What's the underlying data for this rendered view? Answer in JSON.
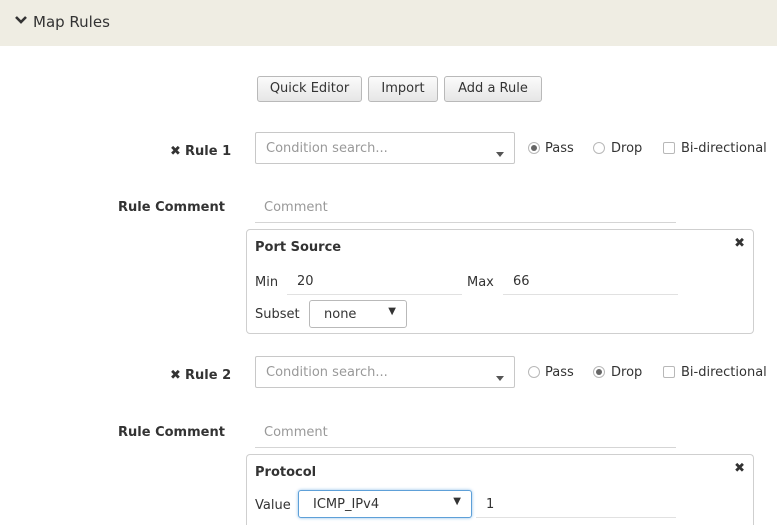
{
  "header": {
    "title": "Map Rules"
  },
  "toolbar": {
    "quick_editor": "Quick Editor",
    "import": "Import",
    "add_rule": "Add a Rule"
  },
  "rules": [
    {
      "label": "Rule 1",
      "condition_placeholder": "Condition search...",
      "action": "Pass",
      "options": {
        "pass": "Pass",
        "drop": "Drop",
        "bidirectional": "Bi-directional"
      },
      "comment_label": "Rule Comment",
      "comment_placeholder": "Comment",
      "filter": {
        "title": "Port Source",
        "min_label": "Min",
        "min_value": "20",
        "max_label": "Max",
        "max_value": "66",
        "subset_label": "Subset",
        "subset_value": "none"
      }
    },
    {
      "label": "Rule 2",
      "condition_placeholder": "Condition search...",
      "action": "Drop",
      "options": {
        "pass": "Pass",
        "drop": "Drop",
        "bidirectional": "Bi-directional"
      },
      "comment_label": "Rule Comment",
      "comment_placeholder": "Comment",
      "filter": {
        "title": "Protocol",
        "value_label": "Value",
        "value_selected": "ICMP_IPv4",
        "value_number": "1"
      }
    }
  ],
  "icons": {
    "collapse": "chevron-down-icon",
    "remove": "close-icon",
    "dropdown": "caret-down-icon"
  },
  "colors": {
    "header_bg": "#efede3",
    "focus_border": "#5ea0d8"
  }
}
